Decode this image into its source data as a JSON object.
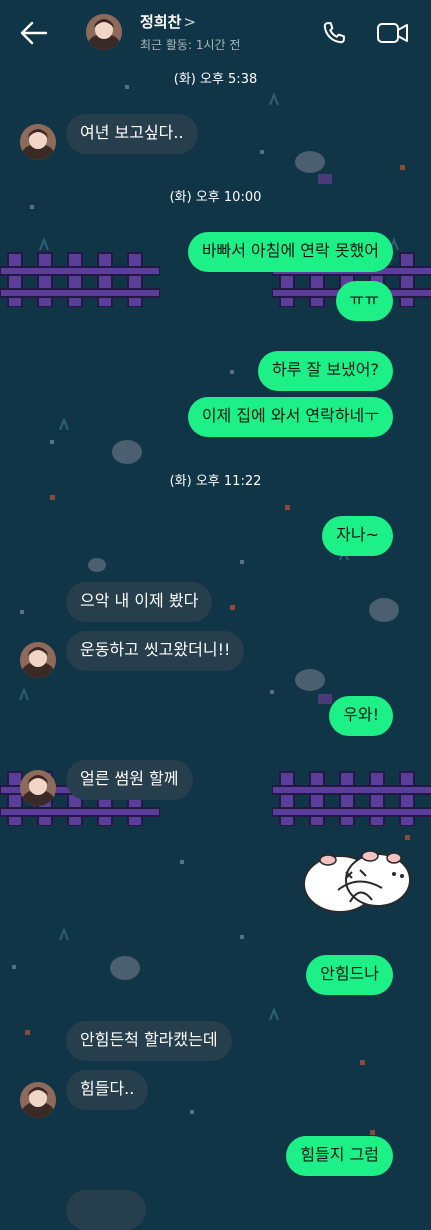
{
  "header": {
    "name": "정희찬",
    "chevron": ">",
    "status": "최근 활동: 1시간 전",
    "icons": [
      "back-arrow-icon",
      "phone-icon",
      "video-camera-icon"
    ]
  },
  "messages": [
    {
      "type": "timestamp",
      "text": "(화) 오후 5:38"
    },
    {
      "type": "in",
      "text": "여년 보고싶다..",
      "avatar": true
    },
    {
      "type": "timestamp",
      "text": "(화) 오후 10:00"
    },
    {
      "type": "out",
      "text": "바빠서 아침에 연락 못했어"
    },
    {
      "type": "out",
      "text": "ㅠㅠ"
    },
    {
      "type": "out",
      "text": "하루 잘 보냈어?"
    },
    {
      "type": "out",
      "text": "이제 집에 와서 연락하네ㅜ"
    },
    {
      "type": "timestamp",
      "text": "(화) 오후 11:22"
    },
    {
      "type": "out",
      "text": "자나~"
    },
    {
      "type": "in",
      "text": "으악 내 이제 봤다"
    },
    {
      "type": "in",
      "text": "운동하고 씻고왔더니!!",
      "avatar": true
    },
    {
      "type": "out",
      "text": "우와!"
    },
    {
      "type": "in",
      "text": "얼른 썸원 할께",
      "avatar": true
    },
    {
      "type": "sticker",
      "icon": "hug-sticker-icon"
    },
    {
      "type": "out",
      "text": "안힘드나"
    },
    {
      "type": "in",
      "text": "안힘든척 할라캤는데"
    },
    {
      "type": "in",
      "text": "힘들다..",
      "avatar": true
    },
    {
      "type": "out",
      "text": "힘들지 그럼"
    }
  ],
  "colors": {
    "background": "#0f3547",
    "incoming_bubble": "#273e4d",
    "outgoing_bubble": "#1df087",
    "fence": "#5b3d9a"
  }
}
